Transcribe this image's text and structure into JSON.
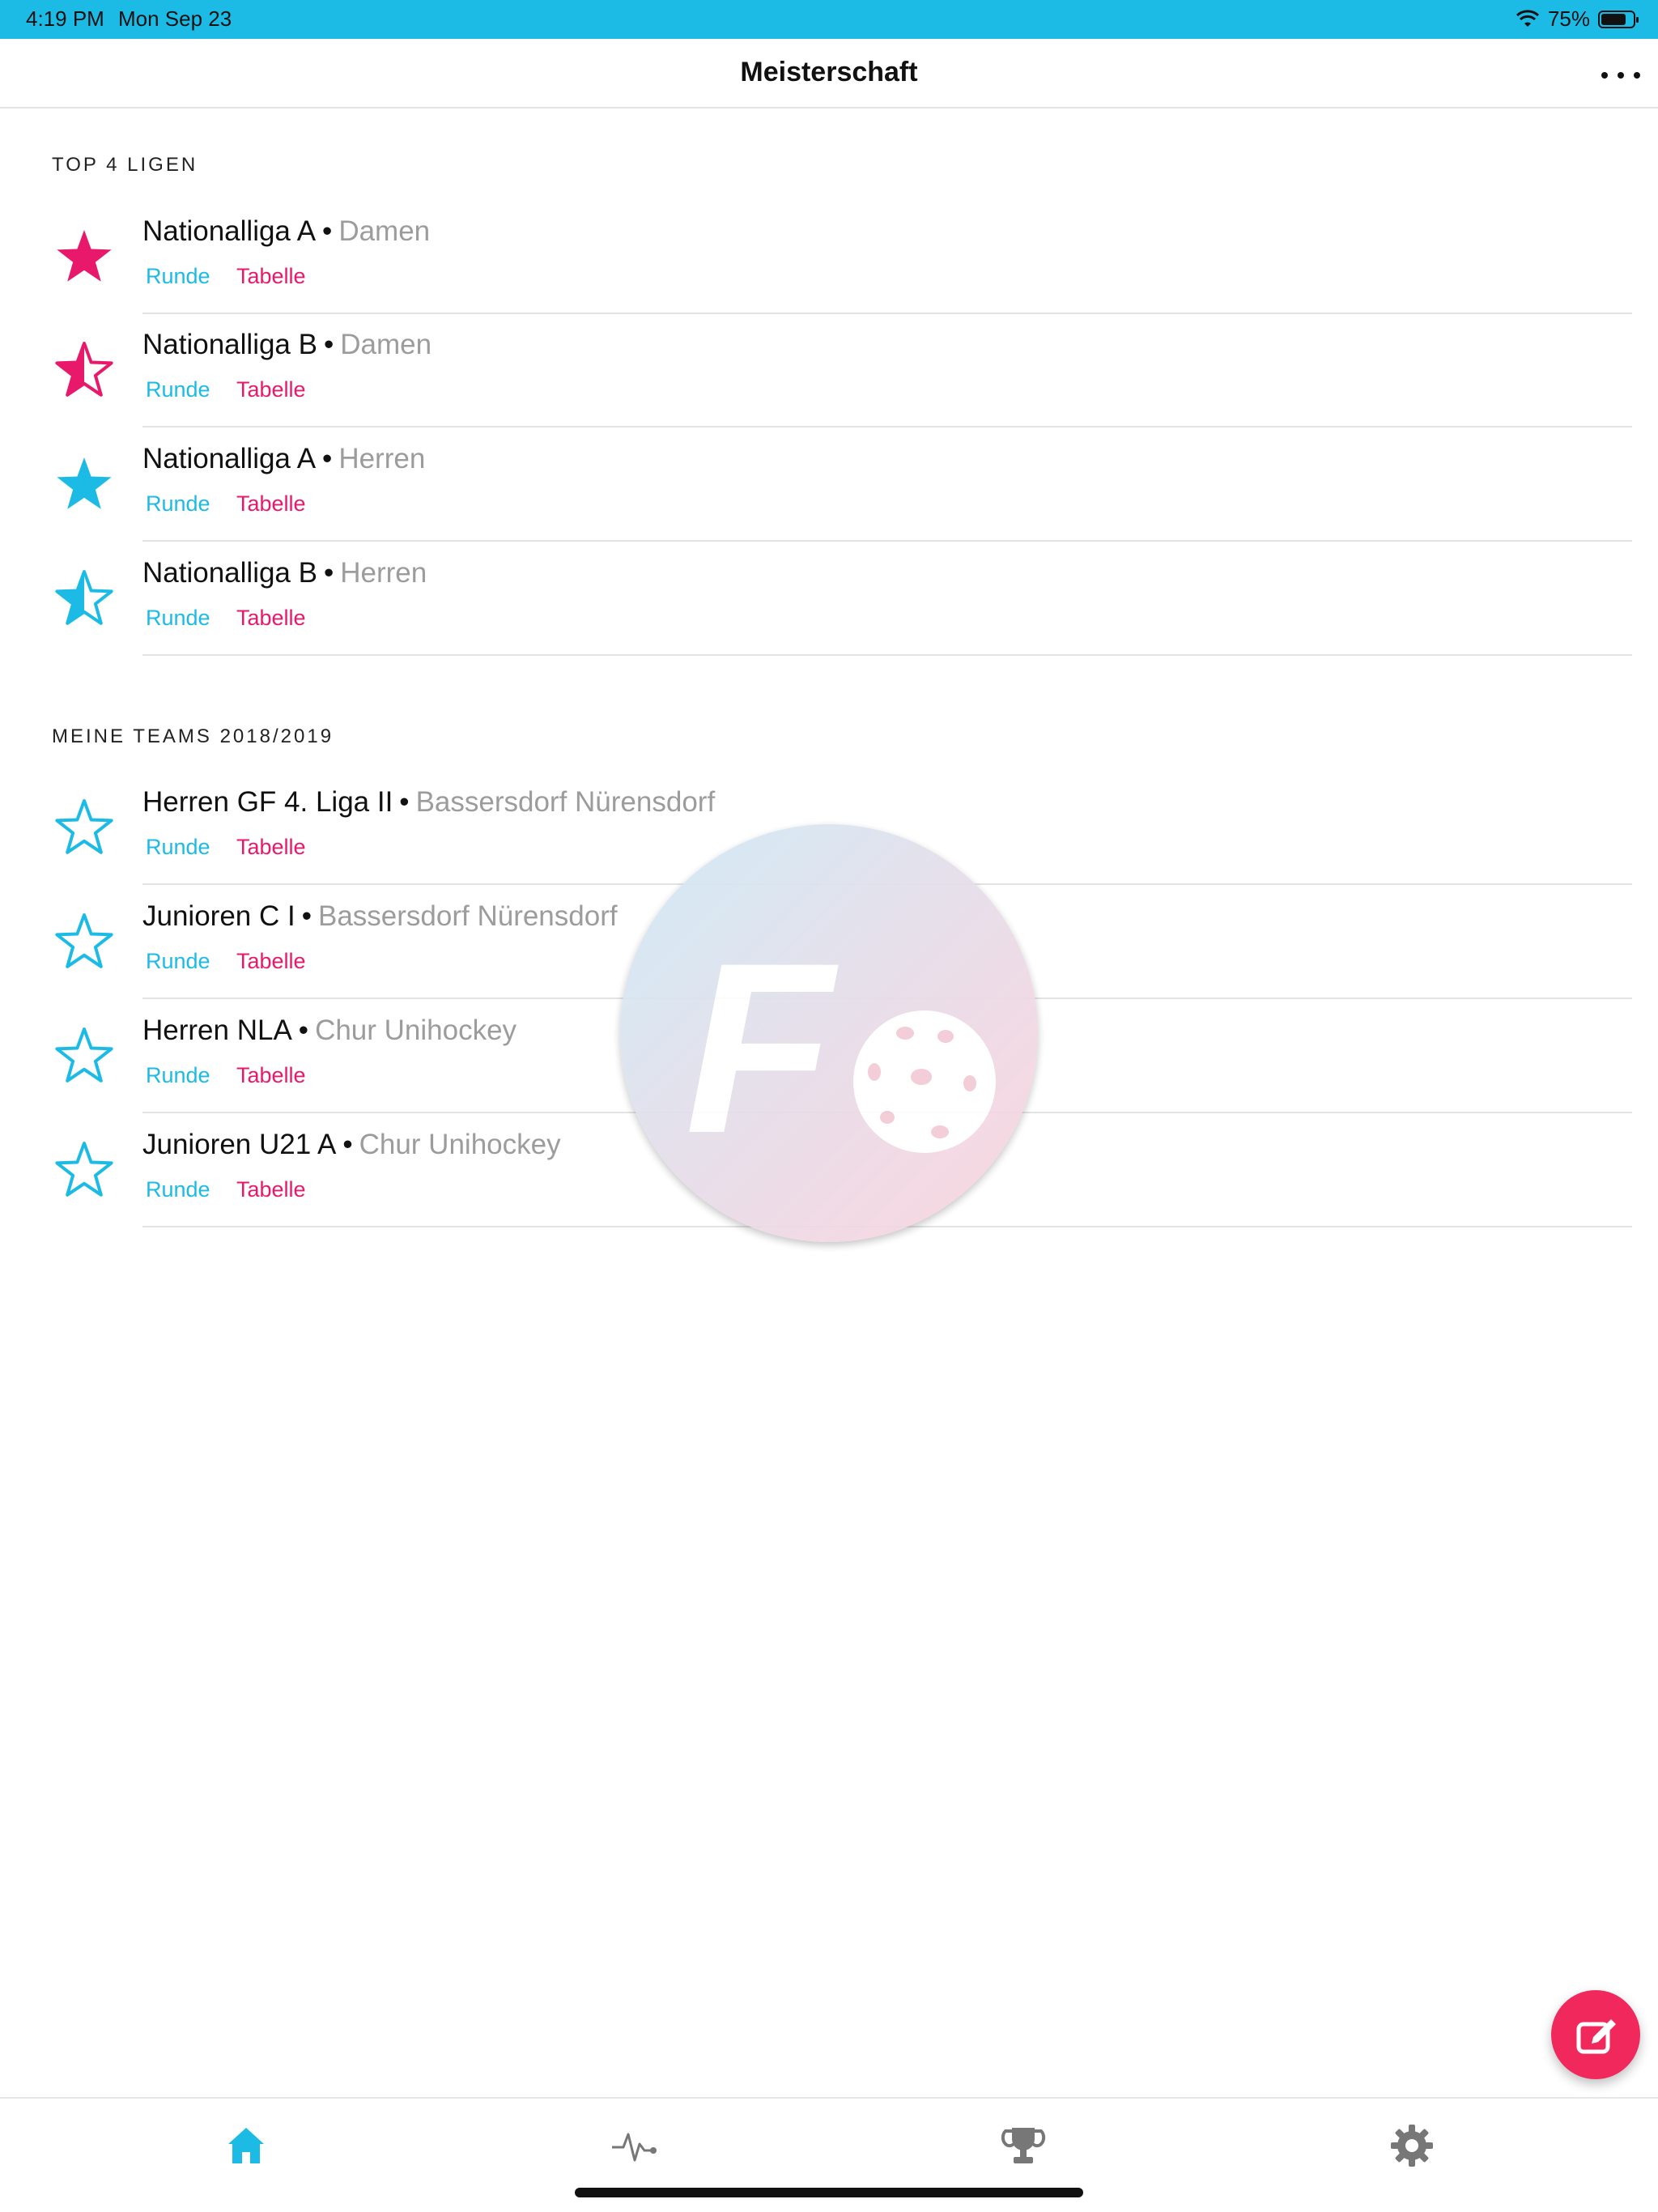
{
  "status_bar": {
    "time": "4:19 PM",
    "date": "Mon Sep 23",
    "battery": "75%",
    "battery_level": 0.75
  },
  "nav": {
    "title": "Meisterschaft"
  },
  "sections": [
    {
      "header": "TOP 4 LIGEN",
      "rows": [
        {
          "title": "Nationalliga A",
          "subtitle": "Damen",
          "runde": "Runde",
          "tabelle": "Tabelle",
          "star": "pink-filled-star-icon"
        },
        {
          "title": "Nationalliga B",
          "subtitle": "Damen",
          "runde": "Runde",
          "tabelle": "Tabelle",
          "star": "pink-half-star-icon"
        },
        {
          "title": "Nationalliga A",
          "subtitle": "Herren",
          "runde": "Runde",
          "tabelle": "Tabelle",
          "star": "blue-filled-star-icon"
        },
        {
          "title": "Nationalliga B",
          "subtitle": "Herren",
          "runde": "Runde",
          "tabelle": "Tabelle",
          "star": "blue-half-star-icon"
        }
      ]
    },
    {
      "header": "MEINE TEAMS 2018/2019",
      "rows": [
        {
          "title": "Herren GF 4. Liga II",
          "subtitle": "Bassersdorf Nürensdorf",
          "runde": "Runde",
          "tabelle": "Tabelle",
          "star": "blue-outline-star-icon"
        },
        {
          "title": "Junioren C I",
          "subtitle": "Bassersdorf Nürensdorf",
          "runde": "Runde",
          "tabelle": "Tabelle",
          "star": "blue-outline-star-icon"
        },
        {
          "title": "Herren NLA",
          "subtitle": "Chur Unihockey",
          "runde": "Runde",
          "tabelle": "Tabelle",
          "star": "blue-outline-star-icon"
        },
        {
          "title": "Junioren U21 A",
          "subtitle": "Chur Unihockey",
          "runde": "Runde",
          "tabelle": "Tabelle",
          "star": "blue-outline-star-icon"
        }
      ]
    }
  ],
  "watermark": {
    "letter": "F"
  },
  "tabs": [
    {
      "icon": "home-icon",
      "active": true
    },
    {
      "icon": "activity-icon",
      "active": false
    },
    {
      "icon": "trophy-icon",
      "active": false
    },
    {
      "icon": "gear-icon",
      "active": false
    }
  ],
  "colors": {
    "accent_blue": "#1cbbe6",
    "accent_pink": "#e8196b",
    "fab": "#f0285c",
    "subtitle_gray": "#9c9c9c"
  }
}
